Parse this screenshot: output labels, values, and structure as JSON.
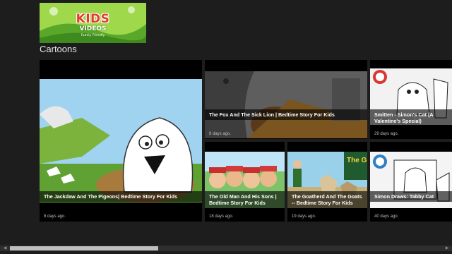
{
  "app": {
    "logo": {
      "title": "KIDS",
      "subtitle": "VIDEOS",
      "tagline": "Family Friendly"
    },
    "section_title": "Cartoons"
  },
  "videos": [
    {
      "title": "The Jackdaw And The Pigeons| Bedtime Story For Kids",
      "age": "8 days ago."
    },
    {
      "title": "The Fox And The Sick Lion | Bedtime Story For Kids",
      "age": "8 days ago."
    },
    {
      "title": "Smitten - Simon's Cat (A Valentine's Special)",
      "age": "29 days ago."
    },
    {
      "title": "The Old Man And His Sons | Bedtime Story For Kids",
      "age": "18 days ago."
    },
    {
      "title": "The Goatherd And The Goats -- Bedtime Story For Kids",
      "age": "19 days ago."
    },
    {
      "title": "Simon Draws: Tabby Cat",
      "age": "40 days ago."
    }
  ],
  "scrollbar": {
    "left_arrow": "◀",
    "right_arrow": "▶"
  }
}
